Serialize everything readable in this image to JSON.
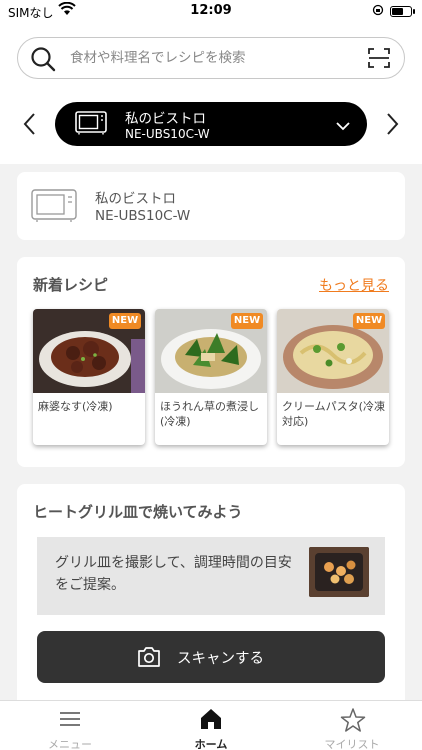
{
  "status_bar": {
    "carrier": "SIMなし",
    "time": "12:09",
    "battery_level": 0.6
  },
  "search": {
    "placeholder": "食材や料理名でレシピを検索"
  },
  "device_selector": {
    "name": "私のビストロ",
    "model": "NE-UBS10C-W"
  },
  "device_card": {
    "name": "私のビストロ",
    "model": "NE-UBS10C-W"
  },
  "new_recipes": {
    "title": "新着レシピ",
    "more_label": "もっと見る",
    "badge": "NEW",
    "items": [
      {
        "name": "麻婆なす(冷凍)"
      },
      {
        "name": "ほうれん草の煮浸し(冷凍)"
      },
      {
        "name": "クリームパスタ(冷凍対応)"
      }
    ]
  },
  "grill": {
    "title": "ヒートグリル皿で焼いてみよう",
    "description": "グリル皿を撮影して、調理時間の目安をご提案。",
    "button_label": "スキャンする"
  },
  "tabbar": {
    "items": [
      {
        "label": "メニュー"
      },
      {
        "label": "ホーム"
      },
      {
        "label": "マイリスト"
      }
    ]
  },
  "colors": {
    "accent": "#f07b1e",
    "badge": "#f08a24",
    "pill": "#000000",
    "button": "#333333"
  }
}
